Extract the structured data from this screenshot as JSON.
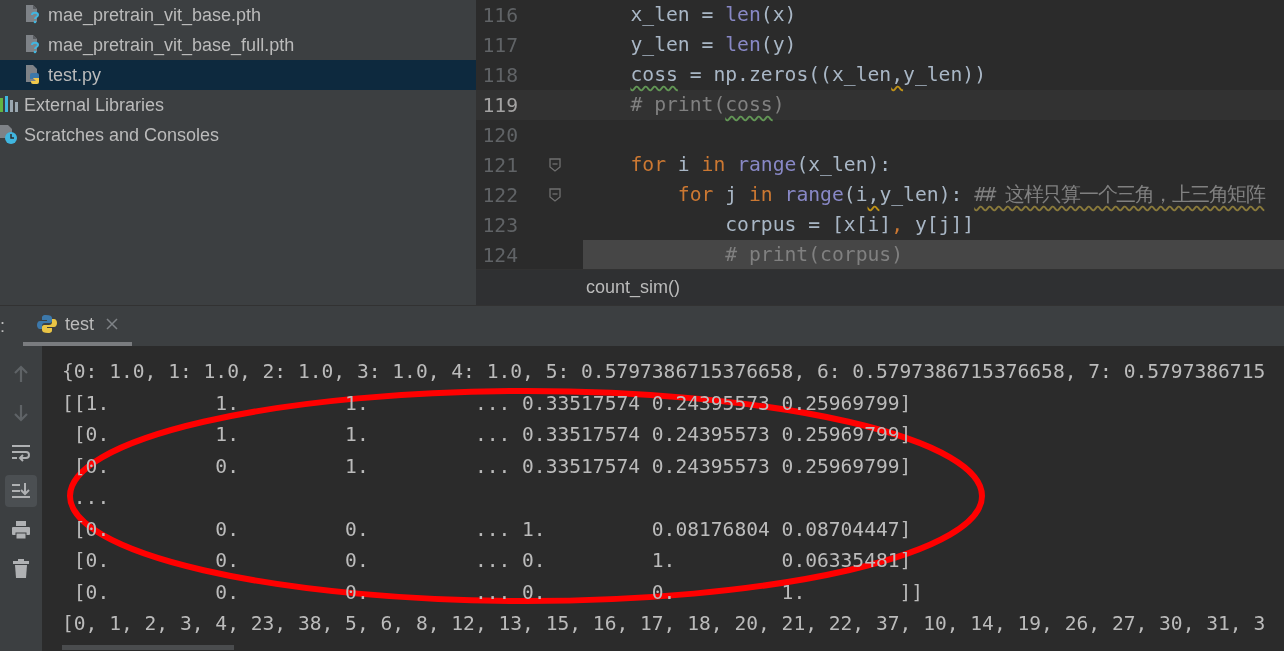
{
  "project_tree": {
    "files": [
      {
        "label": "mae_pretrain_vit_base.pth",
        "kind": "unknown",
        "selected": false
      },
      {
        "label": "mae_pretrain_vit_base_full.pth",
        "kind": "unknown",
        "selected": false
      },
      {
        "label": "test.py",
        "kind": "python",
        "selected": true
      }
    ],
    "roots": [
      {
        "label": "External Libraries",
        "kind": "libraries",
        "selected": false
      },
      {
        "label": "Scratches and Consoles",
        "kind": "scratches",
        "selected": false
      }
    ]
  },
  "editor": {
    "lines": [
      {
        "number": "116",
        "current": false,
        "highlighted": false,
        "fold": false,
        "tokens": [
          {
            "kind": "plain",
            "text": "    x_len = "
          },
          {
            "kind": "builtin",
            "text": "len"
          },
          {
            "kind": "plain",
            "text": "(x)"
          }
        ]
      },
      {
        "number": "117",
        "current": false,
        "highlighted": false,
        "fold": false,
        "tokens": [
          {
            "kind": "plain",
            "text": "    y_len = "
          },
          {
            "kind": "builtin",
            "text": "len"
          },
          {
            "kind": "plain",
            "text": "(y)"
          }
        ]
      },
      {
        "number": "118",
        "current": false,
        "highlighted": false,
        "fold": false,
        "tokens": [
          {
            "kind": "plain",
            "text": "    coss",
            "typo": true
          },
          {
            "kind": "plain",
            "text": " = np.zeros((x_len"
          },
          {
            "kind": "plain",
            "text": ",",
            "warning": true
          },
          {
            "kind": "plain",
            "text": "y_len))"
          }
        ]
      },
      {
        "number": "119",
        "current": true,
        "highlighted": false,
        "fold": false,
        "tokens": [
          {
            "kind": "comment",
            "text": "    # print("
          },
          {
            "kind": "comment",
            "text": "coss",
            "typo": true
          },
          {
            "kind": "comment",
            "text": ")"
          }
        ]
      },
      {
        "number": "120",
        "current": false,
        "highlighted": false,
        "fold": false
      },
      {
        "number": "121",
        "current": false,
        "highlighted": false,
        "fold": true,
        "tokens": [
          {
            "kind": "keyword",
            "text": "    for"
          },
          {
            "kind": "plain",
            "text": " i "
          },
          {
            "kind": "keyword",
            "text": "in "
          },
          {
            "kind": "builtin",
            "text": "range"
          },
          {
            "kind": "plain",
            "text": "(x_len):"
          }
        ]
      },
      {
        "number": "122",
        "current": false,
        "highlighted": false,
        "fold": true,
        "tokens": [
          {
            "kind": "keyword",
            "text": "        for"
          },
          {
            "kind": "plain",
            "text": " j "
          },
          {
            "kind": "keyword",
            "text": "in "
          },
          {
            "kind": "builtin",
            "text": "range"
          },
          {
            "kind": "plain",
            "text": "(i"
          },
          {
            "kind": "plain",
            "text": ",",
            "warning": true
          },
          {
            "kind": "plain",
            "text": "y_len):"
          },
          {
            "kind": "comment",
            "text": " ## 这样只算一个三角，上三角矩阵",
            "weak_warning": true
          }
        ]
      },
      {
        "number": "123",
        "current": false,
        "highlighted": false,
        "fold": false,
        "tokens": [
          {
            "kind": "plain",
            "text": "            corpus = [x[i]"
          },
          {
            "kind": "keyword",
            "text": ", "
          },
          {
            "kind": "plain",
            "text": "y[j]]"
          }
        ]
      },
      {
        "number": "124",
        "current": false,
        "highlighted": true,
        "fold": false,
        "tokens": [
          {
            "kind": "comment",
            "text": "            # print(corpus)"
          }
        ]
      }
    ],
    "breadcrumb": "count_sim()"
  },
  "run_panel": {
    "label": ":",
    "tabs": [
      {
        "label": "test",
        "selected": true
      }
    ],
    "toolbar": [
      {
        "kind": "up",
        "selected": false
      },
      {
        "kind": "down",
        "selected": false
      },
      {
        "kind": "wrap",
        "selected": false
      },
      {
        "kind": "scroll-end",
        "selected": true
      },
      {
        "kind": "print",
        "selected": false
      },
      {
        "kind": "trash",
        "selected": false
      }
    ],
    "output": [
      "{0: 1.0, 1: 1.0, 2: 1.0, 3: 1.0, 4: 1.0, 5: 0.5797386715376658, 6: 0.5797386715376658, 7: 0.5797386715",
      "[[1.         1.         1.         ... 0.33517574 0.24395573 0.25969799]",
      " [0.         1.         1.         ... 0.33517574 0.24395573 0.25969799]",
      " [0.         0.         1.         ... 0.33517574 0.24395573 0.25969799]",
      " ...",
      " [0.         0.         0.         ... 1.         0.08176804 0.08704447]",
      " [0.         0.         0.         ... 0.         1.         0.06335481]",
      " [0.         0.         0.         ... 0.         0.         1.        ]]",
      "[0, 1, 2, 3, 4, 23, 38, 5, 6, 8, 12, 13, 15, 16, 17, 18, 20, 21, 22, 37, 10, 14, 19, 26, 27, 30, 31, 3"
    ]
  },
  "annotations": [
    {
      "kind": "ellipse"
    }
  ]
}
